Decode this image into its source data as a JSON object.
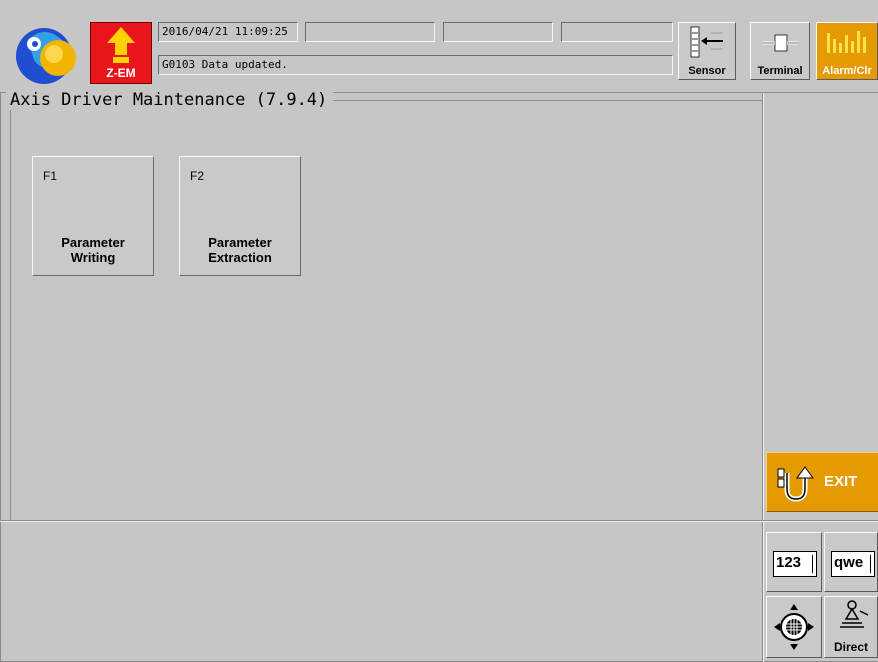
{
  "header": {
    "datetime": "2016/04/21 11:09:25",
    "status_fields": [
      "",
      "",
      ""
    ],
    "message": "G0103  Data updated.",
    "mode_badge": "Z-EM",
    "buttons": {
      "sensor": "Sensor",
      "terminal": "Terminal",
      "alarm_clear": "Alarm/Clr"
    }
  },
  "panel": {
    "title": "Axis Driver Maintenance  (7.9.4)",
    "functions": [
      {
        "key": "F1",
        "label": "Parameter\nWriting"
      },
      {
        "key": "F2",
        "label": "Parameter\nExtraction"
      }
    ]
  },
  "side": {
    "exit_label": "EXIT"
  },
  "keypad": {
    "numeric": "123",
    "alpha": "qwe",
    "direct": "Direct"
  },
  "colors": {
    "background": "#c6c6c6",
    "alarm_orange": "#e49a00",
    "zem_red": "#e8161a",
    "zem_arrow": "#ffd200"
  },
  "icons": [
    "app-logo-icon",
    "arrow-up-icon",
    "sensor-icon",
    "terminal-icon",
    "alarm-icon",
    "exit-u-turn-icon",
    "cursor-move-icon",
    "direct-teach-icon"
  ]
}
